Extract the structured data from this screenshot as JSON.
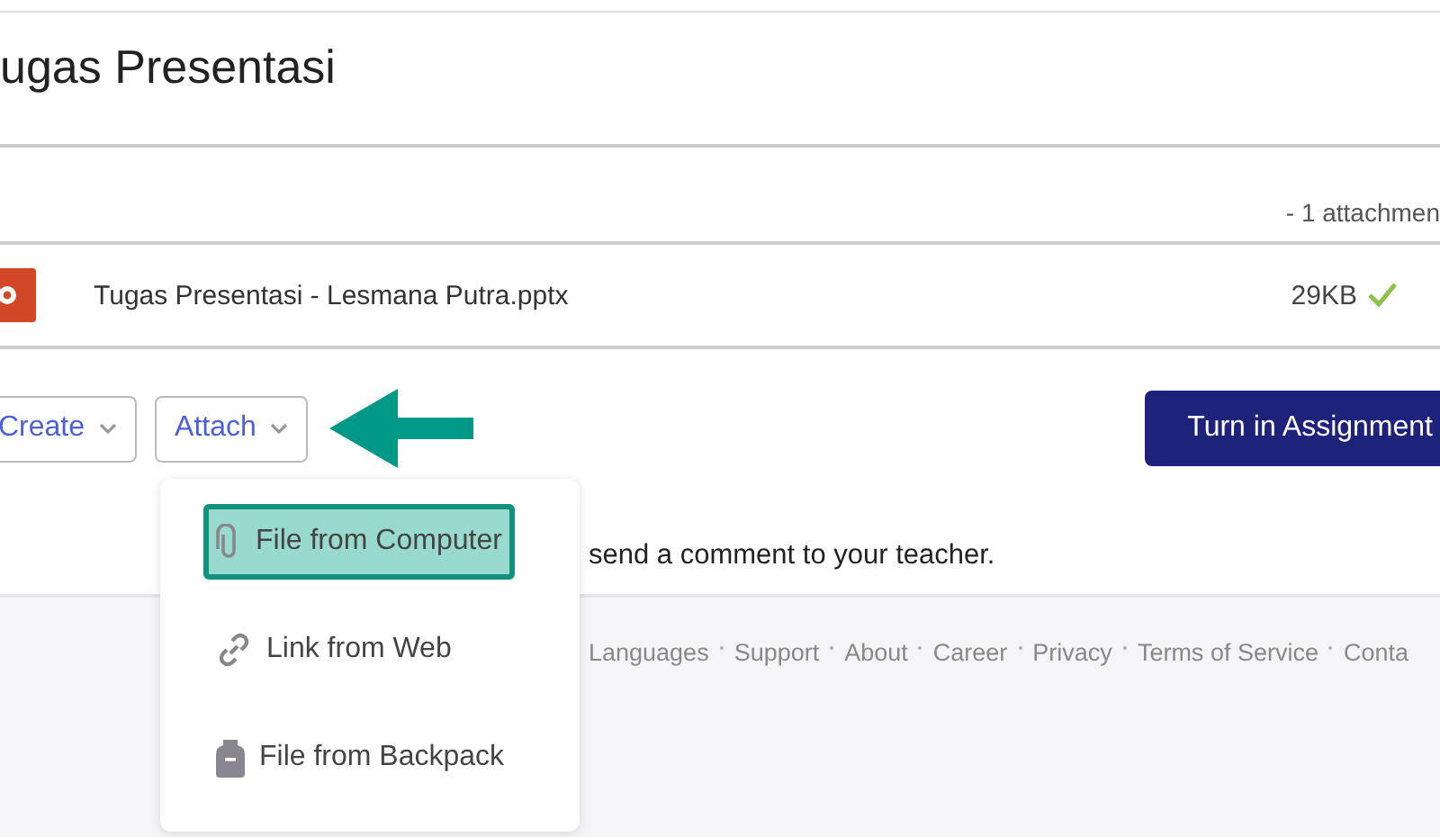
{
  "title": "ugas Presentasi",
  "attachments_count": "- 1 attachmen",
  "file": {
    "name": "Tugas Presentasi - Lesmana Putra.pptx",
    "size": "29KB",
    "uploaded": true
  },
  "buttons": [
    {
      "label": "Create",
      "kind": "dropdown"
    },
    {
      "label": "Attach",
      "kind": "dropdown"
    },
    {
      "label": "Turn in Assignment",
      "kind": "primary"
    }
  ],
  "comment_hint": "send a comment to your teacher.",
  "attach_menu": [
    {
      "label": "File from Computer",
      "kind": "computer",
      "selected": true
    },
    {
      "label": "Link from Web",
      "kind": "link",
      "selected": false
    },
    {
      "label": "File from Backpack",
      "kind": "backpack",
      "selected": false
    }
  ],
  "footer_links": [
    "Languages",
    "Support",
    "About",
    "Career",
    "Privacy",
    "Terms of Service",
    "Conta"
  ]
}
